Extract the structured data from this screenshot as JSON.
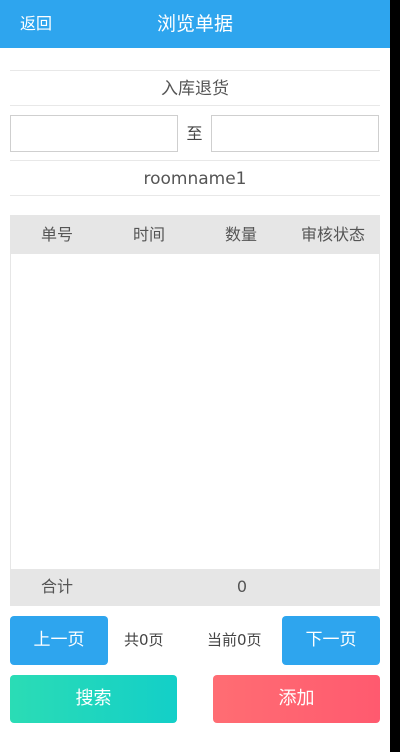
{
  "header": {
    "back_label": "返回",
    "title": "浏览单据",
    "background": "#2ea5ee"
  },
  "document_type": "入库退货",
  "date_range": {
    "start_value": "",
    "end_value": "",
    "separator": "至"
  },
  "room_name": "roomname1",
  "table": {
    "columns": [
      "单号",
      "时间",
      "数量",
      "审核状态"
    ],
    "rows": [],
    "footer": {
      "label": "合计",
      "total": "0"
    }
  },
  "pagination": {
    "prev_label": "上一页",
    "total_pages": "共0页",
    "current_page": "当前0页",
    "next_label": "下一页"
  },
  "actions": {
    "search_label": "搜索",
    "add_label": "添加"
  }
}
